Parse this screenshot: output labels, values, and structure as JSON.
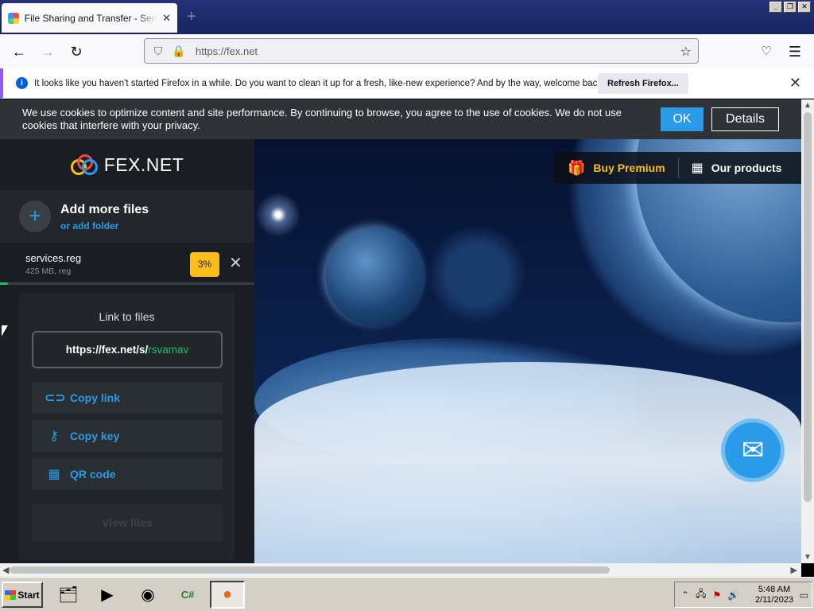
{
  "browser": {
    "tab_title": "File Sharing and Transfer - Send La",
    "url": "https://fex.net"
  },
  "notification": {
    "message": "It looks like you haven't started Firefox in a while. Do you want to clean it up for a fresh, like-new experience? And by the way, welcome back!",
    "button": "Refresh Firefox..."
  },
  "cookie": {
    "text": "We use cookies to optimize content and site performance. By continuing to browse, you agree to the use of cookies. We do not use cookies that interfere with your privacy.",
    "ok": "OK",
    "details": "Details"
  },
  "site": {
    "logo_text": "FEX.NET",
    "add_files": "Add more files",
    "add_folder": "or add folder",
    "buy_premium": "Buy Premium",
    "our_products": "Our products"
  },
  "file": {
    "name": "services.reg",
    "meta": "425 MB, reg",
    "percent": "3%",
    "progress": 0.03
  },
  "share": {
    "label": "Link to files",
    "link_base": "https://fex.net/s/",
    "link_key": "rsvamav",
    "copy_link": "Copy link",
    "copy_key": "Copy key",
    "qr_code": "QR code",
    "view_files": "View files"
  },
  "taskbar": {
    "start": "Start",
    "time": "5:48 AM",
    "date": "2/11/2023"
  },
  "colors": {
    "accent_blue": "#2a9be8",
    "premium_yellow": "#fbbd1a",
    "link_green": "#19c06a"
  }
}
